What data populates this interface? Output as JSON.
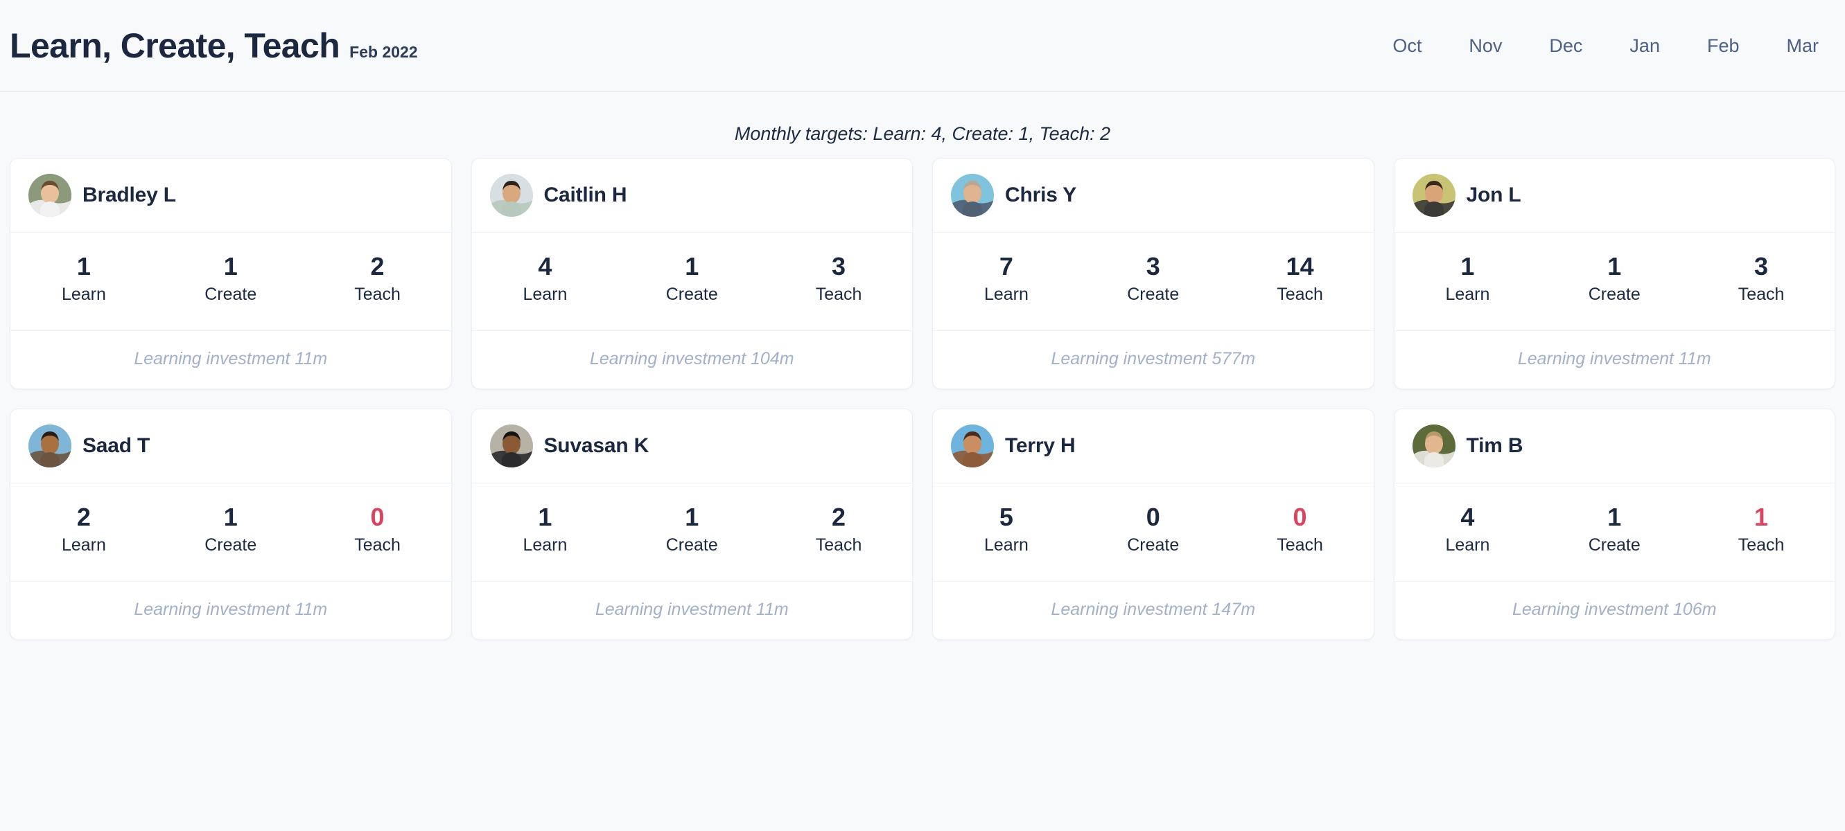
{
  "header": {
    "title": "Learn, Create, Teach",
    "subtitle": "Feb 2022",
    "months": [
      {
        "label": "Oct",
        "active": false
      },
      {
        "label": "Nov",
        "active": false
      },
      {
        "label": "Dec",
        "active": false
      },
      {
        "label": "Jan",
        "active": false
      },
      {
        "label": "Feb",
        "active": true
      },
      {
        "label": "Mar",
        "active": false
      }
    ]
  },
  "targets": {
    "text": "Monthly targets: Learn: 4, Create: 1, Teach: 2",
    "learn": 4,
    "create": 1,
    "teach": 2
  },
  "stat_labels": {
    "learn": "Learn",
    "create": "Create",
    "teach": "Teach"
  },
  "colors": {
    "background": "#f8f9fb",
    "card": "#ffffff",
    "text": "#1b2840",
    "muted": "#a3b0c9",
    "nav": "#4d6087",
    "below_target": "#d94560"
  },
  "people": [
    {
      "name": "Bradley L",
      "avatar_icon": "avatar-photo-bradley",
      "avatar_colors": {
        "bg": "#8a9a7a",
        "skin": "#e8c09c",
        "hair": "#6b4a32",
        "shirt": "#f2f2f2"
      },
      "stats": [
        {
          "key": "learn",
          "label": "Learn",
          "value": "1",
          "below_target": false
        },
        {
          "key": "create",
          "label": "Create",
          "value": "1",
          "below_target": false
        },
        {
          "key": "teach",
          "label": "Teach",
          "value": "2",
          "below_target": false
        }
      ],
      "investment": "Learning investment 11m"
    },
    {
      "name": "Caitlin H",
      "avatar_icon": "avatar-photo-caitlin",
      "avatar_colors": {
        "bg": "#d8dfe2",
        "skin": "#d9a87e",
        "hair": "#2e2119",
        "shirt": "#b7c9bd"
      },
      "stats": [
        {
          "key": "learn",
          "label": "Learn",
          "value": "4",
          "below_target": false
        },
        {
          "key": "create",
          "label": "Create",
          "value": "1",
          "below_target": false
        },
        {
          "key": "teach",
          "label": "Teach",
          "value": "3",
          "below_target": false
        }
      ],
      "investment": "Learning investment 104m"
    },
    {
      "name": "Chris Y",
      "avatar_icon": "avatar-photo-chris",
      "avatar_colors": {
        "bg": "#7fc4dc",
        "skin": "#e0b490",
        "hair": "#b6a893",
        "shirt": "#4f6173"
      },
      "stats": [
        {
          "key": "learn",
          "label": "Learn",
          "value": "7",
          "below_target": false
        },
        {
          "key": "create",
          "label": "Create",
          "value": "3",
          "below_target": false
        },
        {
          "key": "teach",
          "label": "Teach",
          "value": "14",
          "below_target": false
        }
      ],
      "investment": "Learning investment 577m"
    },
    {
      "name": "Jon L",
      "avatar_icon": "avatar-photo-jon",
      "avatar_colors": {
        "bg": "#c9c473",
        "skin": "#d8a478",
        "hair": "#3a2a1e",
        "shirt": "#3c3a36"
      },
      "stats": [
        {
          "key": "learn",
          "label": "Learn",
          "value": "1",
          "below_target": false
        },
        {
          "key": "create",
          "label": "Create",
          "value": "1",
          "below_target": false
        },
        {
          "key": "teach",
          "label": "Teach",
          "value": "3",
          "below_target": false
        }
      ],
      "investment": "Learning investment 11m"
    },
    {
      "name": "Saad T",
      "avatar_icon": "avatar-photo-saad",
      "avatar_colors": {
        "bg": "#7fb6d8",
        "skin": "#a9713f",
        "hair": "#2a1d14",
        "shirt": "#6d5440"
      },
      "stats": [
        {
          "key": "learn",
          "label": "Learn",
          "value": "2",
          "below_target": false
        },
        {
          "key": "create",
          "label": "Create",
          "value": "1",
          "below_target": false
        },
        {
          "key": "teach",
          "label": "Teach",
          "value": "0",
          "below_target": true
        }
      ],
      "investment": "Learning investment 11m"
    },
    {
      "name": "Suvasan K",
      "avatar_icon": "avatar-photo-suvasan",
      "avatar_colors": {
        "bg": "#b7b2a6",
        "skin": "#8a5a34",
        "hair": "#161210",
        "shirt": "#2b2b2d"
      },
      "stats": [
        {
          "key": "learn",
          "label": "Learn",
          "value": "1",
          "below_target": false
        },
        {
          "key": "create",
          "label": "Create",
          "value": "1",
          "below_target": false
        },
        {
          "key": "teach",
          "label": "Teach",
          "value": "2",
          "below_target": false
        }
      ],
      "investment": "Learning investment 11m"
    },
    {
      "name": "Terry H",
      "avatar_icon": "avatar-photo-terry",
      "avatar_colors": {
        "bg": "#6fb4de",
        "skin": "#c98f62",
        "hair": "#4a2c1c",
        "shirt": "#8d5a3a"
      },
      "stats": [
        {
          "key": "learn",
          "label": "Learn",
          "value": "5",
          "below_target": false
        },
        {
          "key": "create",
          "label": "Create",
          "value": "0",
          "below_target": false
        },
        {
          "key": "teach",
          "label": "Teach",
          "value": "0",
          "below_target": true
        }
      ],
      "investment": "Learning investment 147m"
    },
    {
      "name": "Tim B",
      "avatar_icon": "avatar-photo-tim",
      "avatar_colors": {
        "bg": "#5d6b3a",
        "skin": "#e3b78d",
        "hair": "#b79a6a",
        "shirt": "#eceae4"
      },
      "stats": [
        {
          "key": "learn",
          "label": "Learn",
          "value": "4",
          "below_target": false
        },
        {
          "key": "create",
          "label": "Create",
          "value": "1",
          "below_target": false
        },
        {
          "key": "teach",
          "label": "Teach",
          "value": "1",
          "below_target": true
        }
      ],
      "investment": "Learning investment 106m"
    }
  ]
}
